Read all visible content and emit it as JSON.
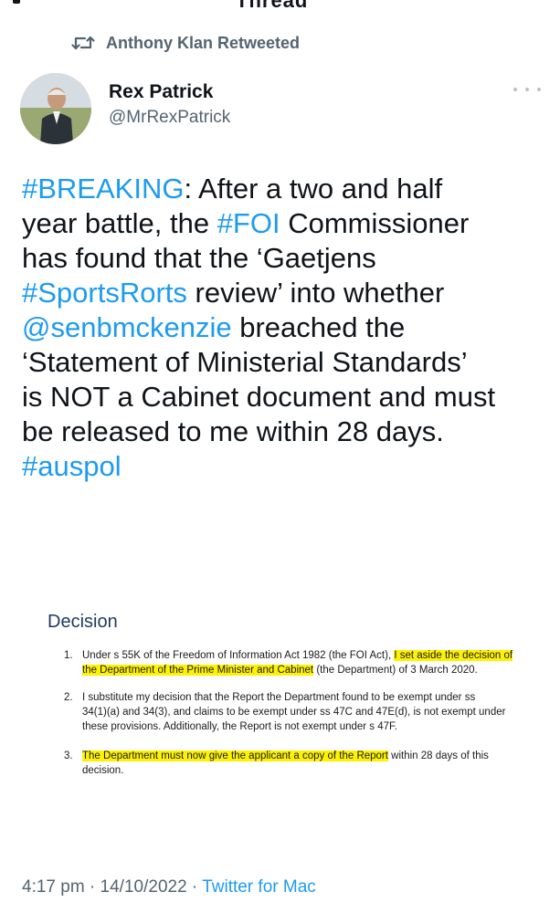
{
  "header": {
    "cut_title": "Thread"
  },
  "retweet": {
    "label": "Anthony Klan Retweeted"
  },
  "author": {
    "display_name": "Rex Patrick",
    "handle": "@MrRexPatrick"
  },
  "tweet": {
    "lines": [
      [
        {
          "t": "#BREAKING",
          "tag": true
        },
        {
          "t": ": After a two and half",
          "tag": false
        }
      ],
      [
        {
          "t": "year battle, the ",
          "tag": false
        },
        {
          "t": "#FOI",
          "tag": true
        },
        {
          "t": " Commissioner",
          "tag": false
        }
      ],
      [
        {
          "t": "has found that the ‘Gaetjens",
          "tag": false
        }
      ],
      [
        {
          "t": "#SportsRorts",
          "tag": true
        },
        {
          "t": " review’ into whether",
          "tag": false
        }
      ],
      [
        {
          "t": "@senbmckenzie",
          "tag": true
        },
        {
          "t": " breached the",
          "tag": false
        }
      ],
      [
        {
          "t": "‘Statement of Ministerial Standards’",
          "tag": false
        }
      ],
      [
        {
          "t": "is NOT a Cabinet document and must",
          "tag": false
        }
      ],
      [
        {
          "t": "be released to me within 28 days.",
          "tag": false
        }
      ],
      [
        {
          "t": "#auspol",
          "tag": true
        }
      ]
    ]
  },
  "document": {
    "heading": "Decision",
    "items": [
      {
        "number": "1.",
        "lines": [
          [
            {
              "t": "Under s 55K of the Freedom of Information Act 1982 (the FOI Act), ",
              "hl": false
            },
            {
              "t": "I set aside the decision of",
              "hl": true
            }
          ],
          [
            {
              "t": "the Department of the Prime Minister and Cabinet",
              "hl": true
            },
            {
              "t": " (the Department) of 3 March 2020.",
              "hl": false
            }
          ]
        ]
      },
      {
        "number": "2.",
        "lines": [
          [
            {
              "t": "I substitute my decision that the Report the Department found to be exempt under ss",
              "hl": false
            }
          ],
          [
            {
              "t": "34(1)(a) and 34(3), and claims to be exempt under ss 47C and 47E(d), is not exempt under",
              "hl": false
            }
          ],
          [
            {
              "t": "these provisions. Additionally, the Report is not exempt under s 47F.",
              "hl": false
            }
          ]
        ]
      },
      {
        "number": "3.",
        "lines": [
          [
            {
              "t": "The Department must now give the applicant a copy of the Report",
              "hl": true
            },
            {
              "t": " within 28 days of this",
              "hl": false
            }
          ],
          [
            {
              "t": "decision.",
              "hl": false
            }
          ]
        ]
      }
    ]
  },
  "meta": {
    "time": "4:17 pm",
    "separator": " · ",
    "date": "14/10/2022",
    "source": "Twitter for Mac"
  },
  "colors": {
    "link": "#1d9bf0",
    "secondary": "#536471",
    "highlight": "#fff200",
    "text": "#0f1419"
  },
  "icons": {
    "retweet": "retweet-icon",
    "more": "more-options-icon"
  }
}
